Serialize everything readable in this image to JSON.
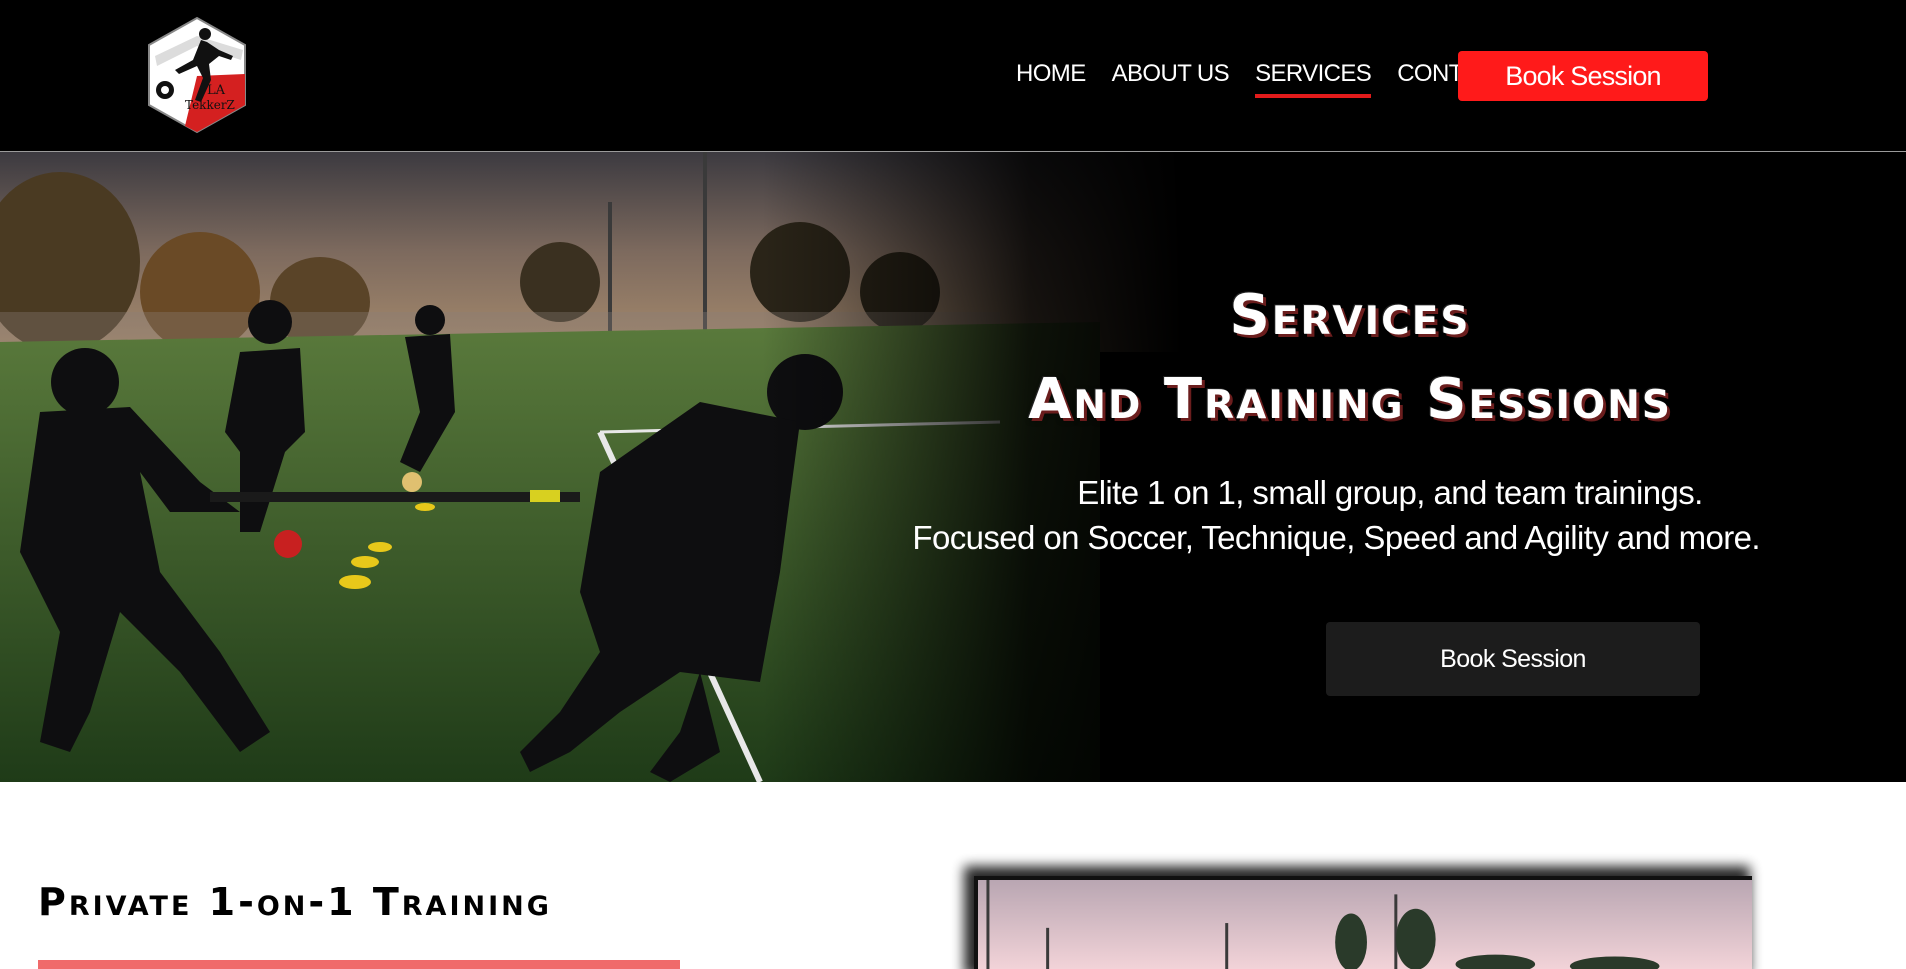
{
  "header": {
    "logo_text": [
      "LA",
      "TekkerZ"
    ],
    "nav": [
      {
        "label": "HOME",
        "active": false
      },
      {
        "label": "ABOUT US",
        "active": false
      },
      {
        "label": "SERVICES",
        "active": true
      },
      {
        "label": "CONTACT",
        "active": false
      }
    ],
    "book_button": "Book Session"
  },
  "hero": {
    "title_line1": "Services",
    "title_line2": "And Training Sessions",
    "subtitle_line1": "Elite 1 on 1, small group, and team trainings.",
    "subtitle_line2": "Focused on Soccer, Technique, Speed and Agility and more.",
    "book_button": "Book Session"
  },
  "services": {
    "section_title": "Private 1-on-1 Training"
  },
  "colors": {
    "accent": "#ff1a1a",
    "nav_underline": "#e21b1b",
    "section_bar": "#f06a6a",
    "header_bg": "#000000",
    "hero_button_bg": "#1c1c1c"
  }
}
